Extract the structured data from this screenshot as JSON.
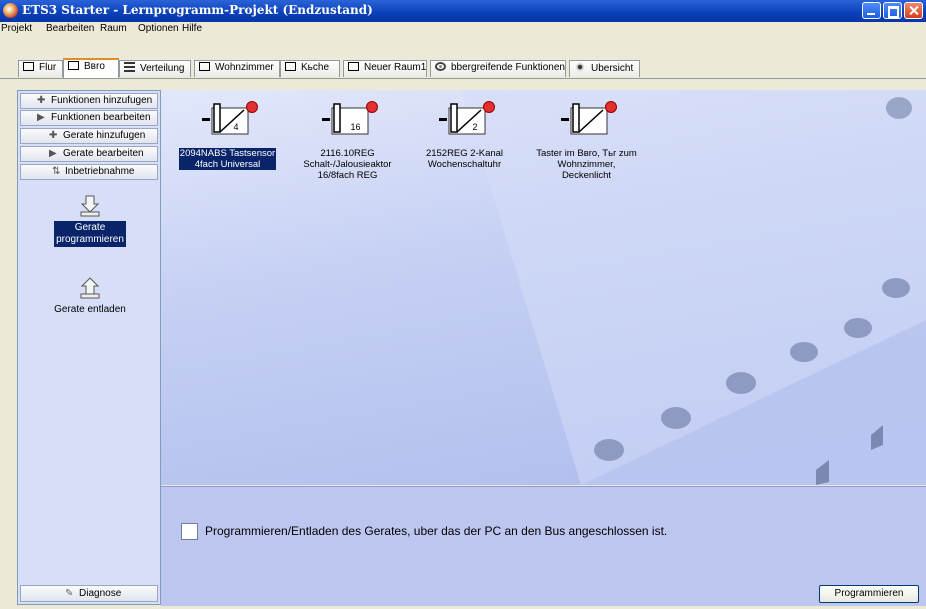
{
  "window": {
    "title": "ETS3 Starter - Lernprogramm-Projekt (Endzustand)"
  },
  "menu": [
    "Projekt",
    "Bearbeiten",
    "Raum",
    "Optionen",
    "Hilfe"
  ],
  "tabs": [
    {
      "label": "Flur",
      "icon": "room-icon"
    },
    {
      "label": "Bвro",
      "icon": "room-icon",
      "active": true
    },
    {
      "label": "Verteilung",
      "icon": "distribution-icon"
    },
    {
      "label": "Wohnzimmer",
      "icon": "room-icon"
    },
    {
      "label": "Kьche",
      "icon": "room-icon"
    },
    {
      "label": "Neuer Raum1",
      "icon": "room-icon"
    },
    {
      "label": "bbergreifende Funktionen",
      "icon": "global-functions-icon"
    },
    {
      "label": "Ubersicht",
      "icon": "overview-icon"
    }
  ],
  "sidebar": {
    "buttons": [
      "Funktionen hinzufugen",
      "Funktionen bearbeiten",
      "Gerate hinzufugen",
      "Gerate bearbeiten",
      "Inbetriebnahme"
    ],
    "actions": [
      {
        "label_line1": "Gerate",
        "label_line2": "programmieren",
        "selected": true
      },
      {
        "label_line1": "Gerate entladen",
        "label_line2": "",
        "selected": false
      }
    ],
    "diagnose": "Diagnose"
  },
  "devices": [
    {
      "number": "4",
      "line1": "2094NABS Tastsensor",
      "line2": "4fach Universal",
      "line3": "",
      "selected": true
    },
    {
      "number": "16",
      "line1": "2116.10REG",
      "line2": "Schalt-/Jalousieaktor",
      "line3": "16/8fach REG",
      "selected": false
    },
    {
      "number": "2",
      "line1": "2152REG 2-Kanal",
      "line2": "Wochenschaltuhr",
      "line3": "",
      "selected": false
    },
    {
      "number": "",
      "line1": "Taster im Bвro, Tьr zum",
      "line2": "Wohnzimmer,",
      "line3": "Deckenlicht",
      "selected": false
    }
  ],
  "bottom": {
    "checkbox_label": "Programmieren/Entladen des Gerates, uber das der PC an den Bus angeschlossen ist.",
    "checkbox_checked": false,
    "program_button": "Programmieren"
  },
  "colors": {
    "titlebar": "#0a3fb8",
    "selection": "#0a246a",
    "workspace": "#c6d0f3",
    "remove_badge": "#e03030"
  }
}
